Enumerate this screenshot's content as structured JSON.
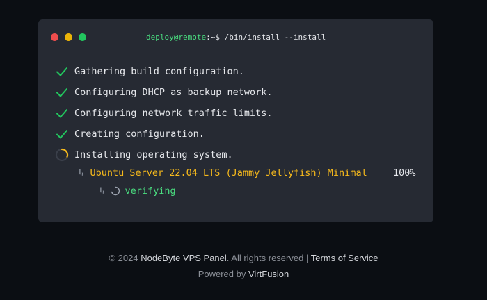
{
  "terminal": {
    "prompt": {
      "userhost": "deploy@remote",
      "separator": ":",
      "path": "~",
      "symbol": "$",
      "command": "/bin/install --install"
    },
    "steps": [
      {
        "status": "done",
        "text": "Gathering build configuration."
      },
      {
        "status": "done",
        "text": "Configuring DHCP as backup network."
      },
      {
        "status": "done",
        "text": "Configuring network traffic limits."
      },
      {
        "status": "done",
        "text": "Creating configuration."
      },
      {
        "status": "in-progress",
        "text": "Installing operating system."
      }
    ],
    "os_install": {
      "arrow": "↳",
      "name": "Ubuntu Server 22.04 LTS (Jammy Jellyfish) Minimal",
      "progress": "100%",
      "progress_value": 1.0
    },
    "sub_status": {
      "arrow": "↳",
      "text": "verifying"
    }
  },
  "colors": {
    "background": "#0b0e13",
    "terminal_bg": "#262a33",
    "check": "#22c55e",
    "spinner": "#f6b91c",
    "os_name": "#f6b91c",
    "verify": "#4ade80"
  },
  "icons": {
    "window_close": "red-dot-icon",
    "window_minimize": "yellow-dot-icon",
    "window_maximize": "green-dot-icon",
    "done": "check-icon",
    "in_progress": "spinner-icon"
  },
  "footer": {
    "copyright": "© 2024",
    "brand": "NodeByte VPS Panel",
    "rights": ". All rights reserved |",
    "terms": "Terms of Service",
    "powered_by": "Powered by",
    "provider": "VirtFusion"
  }
}
